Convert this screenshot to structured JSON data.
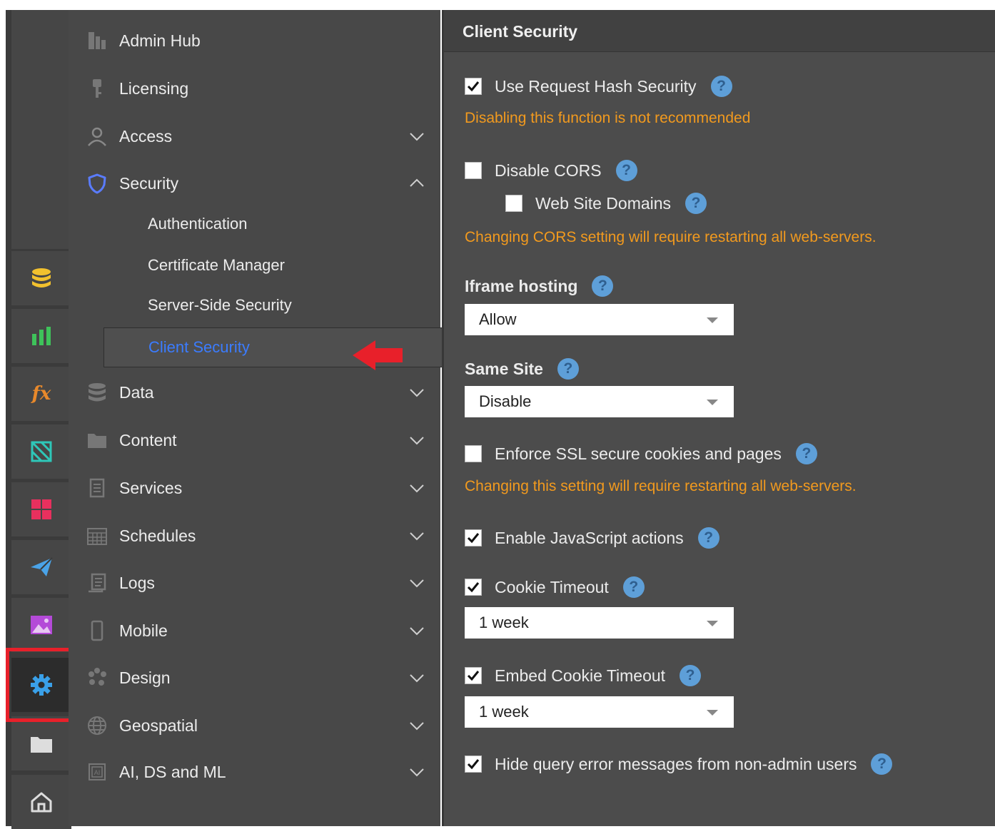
{
  "rail": {
    "items": [
      {
        "icon": "database-icon",
        "color": "#f2c12e"
      },
      {
        "icon": "bar-chart-icon",
        "color": "#3ec35a"
      },
      {
        "icon": "fx-icon",
        "color": "#e8892b",
        "label": "fx"
      },
      {
        "icon": "cube-grid-icon",
        "color": "#2ec7b8"
      },
      {
        "icon": "dashboard-tiles-icon",
        "color": "#e8305e"
      },
      {
        "icon": "paper-plane-icon",
        "color": "#4aa3e8"
      },
      {
        "icon": "image-icon",
        "color": "#b44ad8"
      },
      {
        "icon": "gear-icon",
        "color": "#3aa0e8",
        "active": true
      },
      {
        "icon": "folder-icon",
        "color": "#dddddd"
      },
      {
        "icon": "home-icon",
        "color": "#dddddd"
      }
    ]
  },
  "nav": {
    "items": [
      {
        "label": "Admin Hub",
        "icon": "admin-hub-icon"
      },
      {
        "label": "Licensing",
        "icon": "key-icon"
      },
      {
        "label": "Access",
        "icon": "user-icon",
        "expand": "down"
      },
      {
        "label": "Security",
        "icon": "shield-icon",
        "expand": "up"
      },
      {
        "label": "Data",
        "icon": "database-icon",
        "expand": "down"
      },
      {
        "label": "Content",
        "icon": "folder-icon",
        "expand": "down"
      },
      {
        "label": "Services",
        "icon": "document-icon",
        "expand": "down"
      },
      {
        "label": "Schedules",
        "icon": "calendar-icon",
        "expand": "down"
      },
      {
        "label": "Logs",
        "icon": "log-icon",
        "expand": "down"
      },
      {
        "label": "Mobile",
        "icon": "mobile-icon",
        "expand": "down"
      },
      {
        "label": "Design",
        "icon": "palette-icon",
        "expand": "down"
      },
      {
        "label": "Geospatial",
        "icon": "globe-icon",
        "expand": "down"
      },
      {
        "label": "AI, DS and ML",
        "icon": "ai-icon",
        "expand": "down"
      }
    ],
    "security_sub": [
      "Authentication",
      "Certificate Manager",
      "Server-Side Security"
    ],
    "selected": "Client Security",
    "selected_color": "#3b7cff",
    "arrow_color": "#e8202a"
  },
  "content": {
    "title": "Client Security",
    "request_hash": {
      "label": "Use Request Hash Security",
      "checked": true
    },
    "request_hash_warning": "Disabling this function is not recommended",
    "disable_cors": {
      "label": "Disable CORS",
      "checked": false
    },
    "web_site_domains": {
      "label": "Web Site Domains",
      "checked": false
    },
    "cors_warning": "Changing CORS setting will require restarting all web-servers.",
    "iframe_hosting": {
      "label": "Iframe hosting",
      "value": "Allow"
    },
    "same_site": {
      "label": "Same Site",
      "value": "Disable"
    },
    "enforce_ssl": {
      "label": "Enforce SSL secure cookies and pages",
      "checked": false
    },
    "ssl_warning": "Changing this setting will require restarting all web-servers.",
    "enable_js": {
      "label": "Enable JavaScript actions",
      "checked": true
    },
    "cookie_timeout": {
      "label": "Cookie Timeout",
      "checked": true,
      "value": "1 week"
    },
    "embed_cookie_timeout": {
      "label": "Embed Cookie Timeout",
      "checked": true,
      "value": "1 week"
    },
    "hide_query_errors": {
      "label": "Hide query error messages from non-admin users",
      "checked": true
    },
    "help_glyph": "?",
    "warning_color": "#f29a1e"
  }
}
